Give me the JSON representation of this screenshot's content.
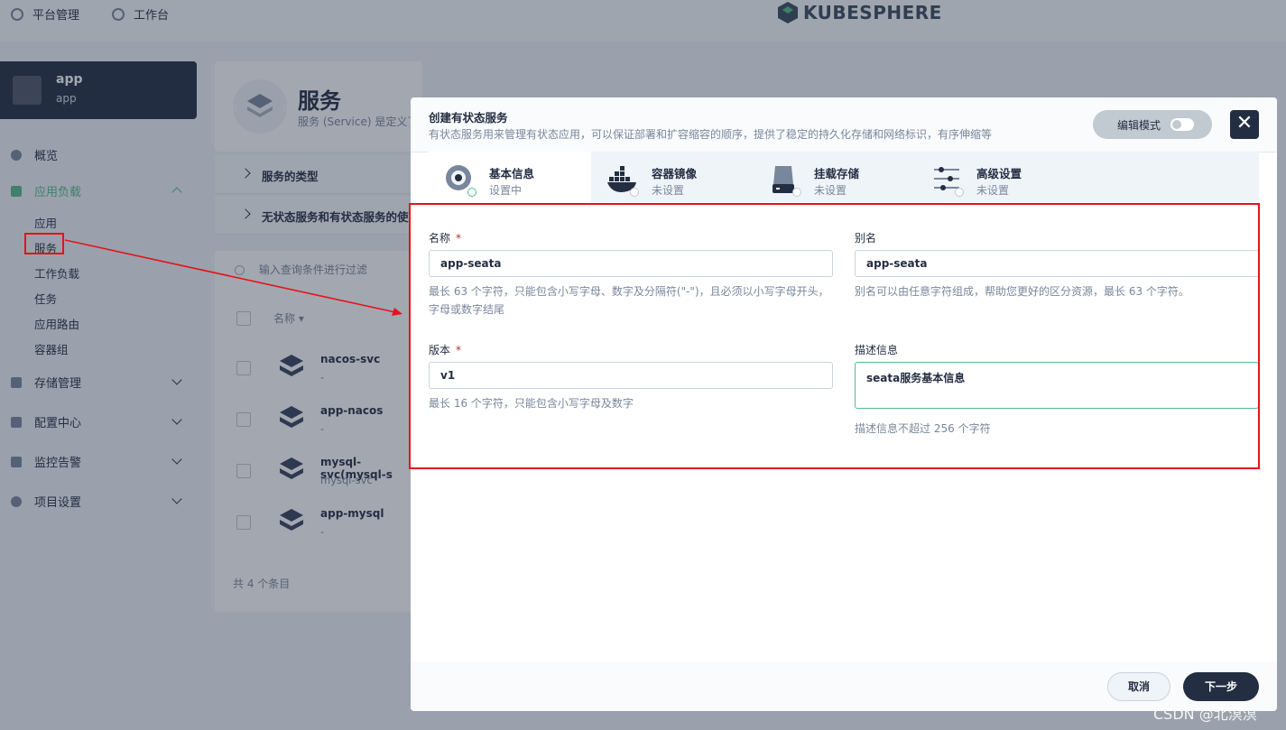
{
  "topbar": {
    "platform_label": "平台管理",
    "workbench_label": "工作台",
    "logo_text": "KUBESPHERE"
  },
  "workspace": {
    "name": "app",
    "sub": "app"
  },
  "sidebar": {
    "overview": "概览",
    "workloads": "应用负载",
    "workload_items": [
      "应用",
      "服务",
      "工作负载",
      "任务",
      "应用路由",
      "容器组"
    ],
    "storage": "存储管理",
    "config": "配置中心",
    "monitoring": "监控告警",
    "settings": "项目设置"
  },
  "page": {
    "title": "服务",
    "desc": "服务 (Service) 是定义了",
    "accordion": [
      "服务的类型",
      "无状态服务和有状态服务的使用"
    ],
    "search_placeholder": "输入查询条件进行过滤",
    "col_name": "名称",
    "rows": [
      {
        "name": "nacos-svc",
        "sub": "-"
      },
      {
        "name": "app-nacos",
        "sub": "-"
      },
      {
        "name": "mysql-svc(mysql-s",
        "sub": "mysql-svc"
      },
      {
        "name": "app-mysql",
        "sub": "-"
      }
    ],
    "total": "共 4 个条目"
  },
  "modal": {
    "title": "创建有状态服务",
    "desc": "有状态服务用来管理有状态应用，可以保证部署和扩容缩容的顺序，提供了稳定的持久化存储和网络标识，有序伸缩等",
    "edit_mode": "编辑模式",
    "close": "✕",
    "tabs": [
      {
        "label": "基本信息",
        "status": "设置中"
      },
      {
        "label": "容器镜像",
        "status": "未设置"
      },
      {
        "label": "挂载存储",
        "status": "未设置"
      },
      {
        "label": "高级设置",
        "status": "未设置"
      }
    ],
    "form": {
      "name_label": "名称",
      "required_mark": "*",
      "name_value": "app-seata",
      "name_help": "最长 63 个字符，只能包含小写字母、数字及分隔符(\"-\")，且必须以小写字母开头，字母或数字结尾",
      "alias_label": "别名",
      "alias_value": "app-seata",
      "alias_help": "别名可以由任意字符组成，帮助您更好的区分资源，最长 63 个字符。",
      "version_label": "版本",
      "version_value": "v1",
      "version_help": "最长 16 个字符，只能包含小写字母及数字",
      "desc_label": "描述信息",
      "desc_value": "seata服务基本信息",
      "desc_help": "描述信息不超过 256 个字符"
    },
    "cancel": "取消",
    "next": "下一步"
  },
  "watermark": "CSDN @北溟溟",
  "colors": {
    "accent": "#55bc8a",
    "dark": "#242e42",
    "annotation": "#e3141b"
  }
}
